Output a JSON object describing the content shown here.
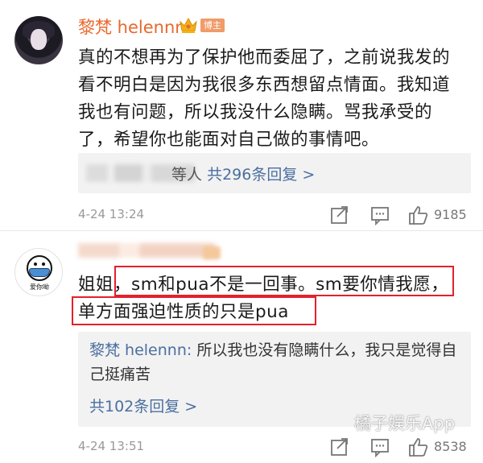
{
  "comments": [
    {
      "username": "黎梵 helennn",
      "badge": "博主",
      "body": "真的不想再为了保护他而委屈了，之前说我发的看不明白是因为我很多东西想留点情面。我知道我也有问题，所以我没什么隐瞒。骂我承受的了，希望你也能面对自己做的事情吧。",
      "replies_summary_suffix": "等人",
      "replies_count_text": "共296条回复 >",
      "timestamp": "4-24 13:24",
      "likes": "9185"
    },
    {
      "avatar_caption": "爱你呦",
      "body_line1_prefix": "姐姐，",
      "body_line1_highlight": "sm和pua不是一回事。sm要你情我愿，",
      "body_line2_highlight": "单方面强迫性质的只是pua",
      "reply_author": "黎梵 helennn:",
      "reply_text": "所以我也没有隐瞒什么，我只是觉得自己挺痛苦",
      "replies_count_text": "共102条回复 >",
      "timestamp": "4-24 13:51",
      "likes": "8538"
    }
  ],
  "watermark": "橘子娱乐App",
  "icons": [
    "share-icon",
    "comment-icon",
    "like-icon",
    "crown-icon"
  ],
  "colors": {
    "username": "#e8682d",
    "link": "#4a6fa0",
    "highlight_box": "#e3212b",
    "badge": "#f09b69"
  }
}
